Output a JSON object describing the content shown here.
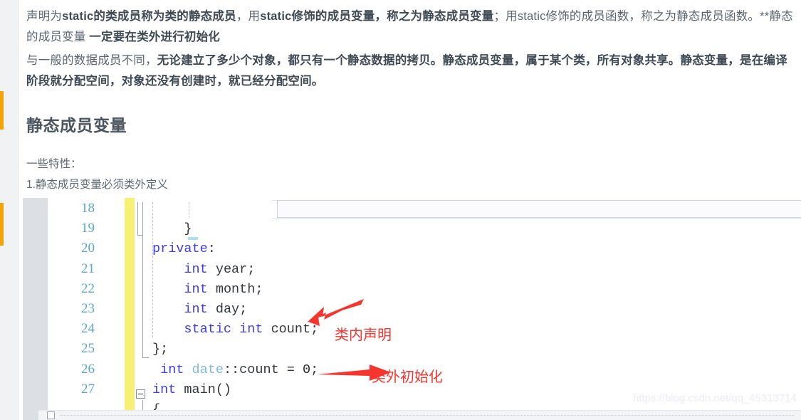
{
  "article": {
    "paragraphs": [
      {
        "id": "para-1",
        "runs": [
          {
            "text": "声明为",
            "bold": false
          },
          {
            "text": "static的类成员称为类的静态成员",
            "bold": true
          },
          {
            "text": "，用",
            "bold": false
          },
          {
            "text": "static修饰的成员变量，称之为静态成员变量",
            "bold": true
          },
          {
            "text": "；用static修饰的成员函数，称之为静态成员函数。**静态的成员变量 ",
            "bold": false
          },
          {
            "text": "一定要在类外进行初始化",
            "bold": true
          }
        ]
      },
      {
        "id": "para-2",
        "runs": [
          {
            "text": "与一般的数据成员不同，",
            "bold": false
          },
          {
            "text": "无论建立了多少个对象，都只有一个静态数据的拷贝。静态成员变量，属于某个类，所有对象共享。静态变量，是在编译阶段就分配空间，对象还没有创建时，就已经分配空间。",
            "bold": true
          }
        ]
      }
    ],
    "heading": "静态成员变量",
    "subtexts": [
      "一些特性：",
      "1.静态成员变量必须类外定义"
    ]
  },
  "code_block": {
    "language": "cpp",
    "lines": [
      {
        "num": "18",
        "tokens": []
      },
      {
        "num": "19",
        "tokens": [
          {
            "t": "    }",
            "c": "plain"
          }
        ]
      },
      {
        "num": "20",
        "tokens": [
          {
            "t": "private",
            "c": "kw"
          },
          {
            "t": ":",
            "c": "plain"
          }
        ]
      },
      {
        "num": "21",
        "tokens": [
          {
            "t": "    ",
            "c": "plain"
          },
          {
            "t": "int",
            "c": "kw"
          },
          {
            "t": " year;",
            "c": "plain"
          }
        ]
      },
      {
        "num": "22",
        "tokens": [
          {
            "t": "    ",
            "c": "plain"
          },
          {
            "t": "int",
            "c": "kw"
          },
          {
            "t": " month;",
            "c": "plain"
          }
        ]
      },
      {
        "num": "23",
        "tokens": [
          {
            "t": "    ",
            "c": "plain"
          },
          {
            "t": "int",
            "c": "kw"
          },
          {
            "t": " day;",
            "c": "plain"
          }
        ]
      },
      {
        "num": "24",
        "tokens": [
          {
            "t": "    ",
            "c": "plain"
          },
          {
            "t": "static",
            "c": "kw"
          },
          {
            "t": " ",
            "c": "plain"
          },
          {
            "t": "int",
            "c": "kw"
          },
          {
            "t": " count;",
            "c": "plain"
          }
        ]
      },
      {
        "num": "25",
        "tokens": [
          {
            "t": "};",
            "c": "plain"
          }
        ]
      },
      {
        "num": "26",
        "tokens": [
          {
            "t": " ",
            "c": "plain"
          },
          {
            "t": "int",
            "c": "kw"
          },
          {
            "t": " ",
            "c": "plain"
          },
          {
            "t": "date",
            "c": "cls"
          },
          {
            "t": "::count = ",
            "c": "plain"
          },
          {
            "t": "0",
            "c": "num"
          },
          {
            "t": ";",
            "c": "plain"
          }
        ]
      },
      {
        "num": "27",
        "tokens": [
          {
            "t": "int",
            "c": "kw"
          },
          {
            "t": " main()",
            "c": "plain"
          }
        ]
      },
      {
        "num": "",
        "tokens": [
          {
            "t": "{",
            "c": "plain"
          }
        ]
      }
    ]
  },
  "annotations": [
    {
      "id": "annot-1",
      "label": "类内声明",
      "arrow": "arrow-up-left",
      "color": "#f5352e"
    },
    {
      "id": "annot-2",
      "label": "类外初始化",
      "arrow": "arrow-right",
      "color": "#f5352e"
    }
  ],
  "watermark": "https://blog.csdn.net/qq_45313714",
  "colors": {
    "accent_orange": "#f5a302",
    "changebar_yellow": "#f7f173",
    "linenum_blue": "#5aa8c8",
    "keyword_blue": "#3d3df5",
    "class_blue": "#7fb8e0",
    "annotation_red": "#f5352e",
    "body_text": "#5a6570"
  }
}
